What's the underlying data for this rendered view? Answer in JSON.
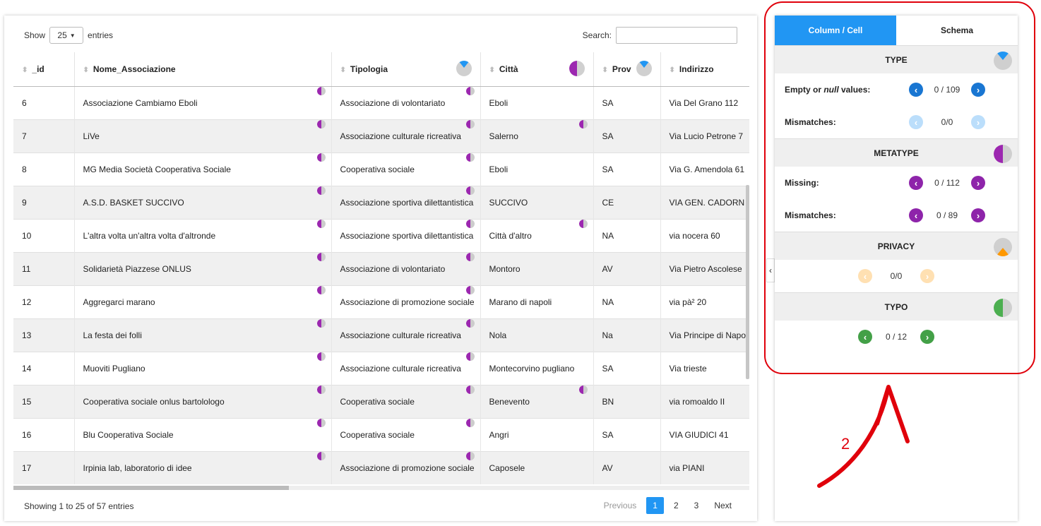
{
  "length_menu": {
    "show_label": "Show",
    "value": "25",
    "entries_label": "entries"
  },
  "search": {
    "label": "Search:",
    "value": ""
  },
  "columns": [
    "_id",
    "Nome_Associazione",
    "Tipologia",
    "Città",
    "Prov",
    "Indirizzo"
  ],
  "rows": [
    [
      "6",
      "Associazione Cambiamo Eboli",
      "Associazione di volontariato",
      "Eboli",
      "SA",
      "Via Del Grano 112"
    ],
    [
      "7",
      "LiVe",
      "Associazione culturale ricreativa",
      "Salerno",
      "SA",
      "Via Lucio Petrone 7"
    ],
    [
      "8",
      "MG Media Società  Cooperativa Sociale",
      "Cooperativa sociale",
      "Eboli",
      "SA",
      "Via G. Amendola 61"
    ],
    [
      "9",
      "A.S.D. BASKET SUCCIVO",
      "Associazione sportiva dilettantistica",
      "SUCCIVO",
      "CE",
      "VIA GEN. CADORN"
    ],
    [
      "10",
      "L'altra volta un'altra volta d'altronde",
      "Associazione sportiva dilettantistica",
      "Città  d'altro",
      "NA",
      "via nocera 60"
    ],
    [
      "11",
      "Solidarietà  Piazzese ONLUS",
      "Associazione di volontariato",
      "Montoro",
      "AV",
      "Via Pietro Ascolese"
    ],
    [
      "12",
      "Aggregarci marano",
      "Associazione di promozione sociale",
      "Marano di napoli",
      "NA",
      "via pà² 20"
    ],
    [
      "13",
      "La festa dei folli",
      "Associazione culturale ricreativa",
      "Nola",
      "Na",
      "Via Principe di Napo"
    ],
    [
      "14",
      "Muoviti Pugliano",
      "Associazione culturale ricreativa",
      "Montecorvino pugliano",
      "SA",
      "Via trieste"
    ],
    [
      "15",
      "Cooperativa sociale onlus bartolologo",
      "Cooperativa sociale",
      "Benevento",
      "BN",
      "via romoaldo II"
    ],
    [
      "16",
      "Blu Cooperativa Sociale",
      "Cooperativa sociale",
      "Angri",
      "SA",
      "VIA GIUDICI 41"
    ],
    [
      "17",
      "Irpinia lab, laboratorio di idee",
      "Associazione di promozione sociale",
      "Caposele",
      "AV",
      "via PIANI"
    ]
  ],
  "footer": {
    "info": "Showing 1 to 25 of 57 entries",
    "pager": [
      "Previous",
      "1",
      "2",
      "3",
      "Next"
    ],
    "active_page": "1"
  },
  "panel": {
    "tabs": [
      "Column / Cell",
      "Schema"
    ],
    "active_tab": "Column / Cell",
    "sections": {
      "type": {
        "title": "TYPE",
        "empty_label_a": "Empty or ",
        "empty_label_i": "null",
        "empty_label_b": " values:",
        "empty_count": "0 / 109",
        "mismatch_label": "Mismatches:",
        "mismatch_count": "0/0"
      },
      "metatype": {
        "title": "METATYPE",
        "missing_label": "Missing:",
        "missing_count": "0 / 112",
        "mismatch_label": "Mismatches:",
        "mismatch_count": "0 / 89"
      },
      "privacy": {
        "title": "PRIVACY",
        "count": "0/0"
      },
      "typo": {
        "title": "TYPO",
        "count": "0 / 12"
      }
    },
    "colors": {
      "type": "#2196f3",
      "metatype": "#9c27b0",
      "privacy": "#ff9800",
      "typo": "#4caf50"
    }
  },
  "annotation": {
    "label": "2",
    "color": "#e0000b"
  }
}
